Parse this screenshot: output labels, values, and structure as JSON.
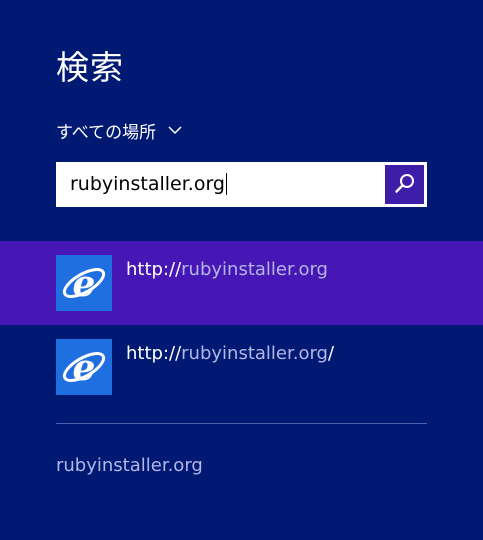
{
  "header": {
    "title": "検索"
  },
  "scope": {
    "label": "すべての場所",
    "icon": "chevron-down-icon"
  },
  "search": {
    "value": "rubyinstaller.org",
    "button_icon": "search-icon"
  },
  "results": [
    {
      "icon": "internet-explorer-icon",
      "prefix": "http://",
      "match": "rubyinstaller.org",
      "suffix": ""
    },
    {
      "icon": "internet-explorer-icon",
      "prefix": "http://",
      "match": "rubyinstaller.org",
      "suffix": "/"
    }
  ],
  "suggestion": {
    "text": "rubyinstaller.org"
  },
  "colors": {
    "background": "#001A73",
    "selected_row": "#4617B5",
    "search_button": "#3D1EA8",
    "highlight_text": "#B3B6E6",
    "ie_tile": "#1F6FE0"
  }
}
